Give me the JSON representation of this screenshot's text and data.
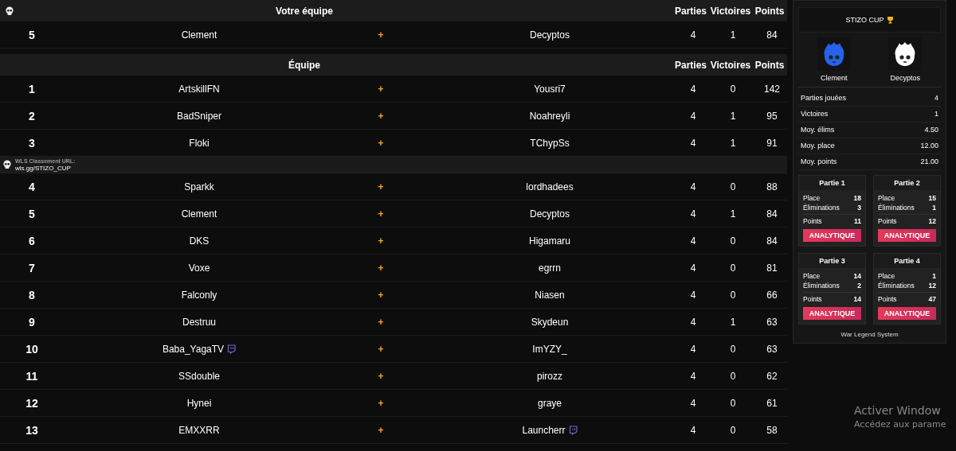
{
  "your_team": {
    "title": "Votre équipe",
    "columns": [
      "Parties",
      "Victoires",
      "Points"
    ],
    "rows": [
      {
        "rank": "5",
        "player_1": {
          "name": "Clement",
          "stream": false
        },
        "plus": "+",
        "player_2": {
          "name": "Decyptos",
          "stream": false
        },
        "parties": "4",
        "victoires": "1",
        "points": "84"
      }
    ]
  },
  "standings": {
    "title": "Équipe",
    "columns": [
      "Parties",
      "Victoires",
      "Points"
    ],
    "rows_top": [
      {
        "rank": "1",
        "player_1": {
          "name": "ArtskillFN",
          "stream": false
        },
        "plus": "+",
        "player_2": {
          "name": "Yousri7",
          "stream": false
        },
        "parties": "4",
        "victoires": "0",
        "points": "142"
      },
      {
        "rank": "2",
        "player_1": {
          "name": "BadSniper",
          "stream": false
        },
        "plus": "+",
        "player_2": {
          "name": "Noahreyli",
          "stream": false
        },
        "parties": "4",
        "victoires": "1",
        "points": "95"
      },
      {
        "rank": "3",
        "player_1": {
          "name": "Floki",
          "stream": false
        },
        "plus": "+",
        "player_2": {
          "name": "TChypSs",
          "stream": false
        },
        "parties": "4",
        "victoires": "1",
        "points": "91"
      }
    ],
    "banner": {
      "label": "WLS Classement URL:",
      "url": "wls.gg/STIZO_CUP"
    },
    "rows_bottom": [
      {
        "rank": "4",
        "player_1": {
          "name": "Sparkk",
          "stream": false
        },
        "plus": "+",
        "player_2": {
          "name": "lordhadees",
          "stream": false
        },
        "parties": "4",
        "victoires": "0",
        "points": "88"
      },
      {
        "rank": "5",
        "player_1": {
          "name": "Clement",
          "stream": false
        },
        "plus": "+",
        "player_2": {
          "name": "Decyptos",
          "stream": false
        },
        "parties": "4",
        "victoires": "1",
        "points": "84"
      },
      {
        "rank": "6",
        "player_1": {
          "name": "DKS",
          "stream": false
        },
        "plus": "+",
        "player_2": {
          "name": "Higamaru",
          "stream": false
        },
        "parties": "4",
        "victoires": "0",
        "points": "84"
      },
      {
        "rank": "7",
        "player_1": {
          "name": "Voxe",
          "stream": false
        },
        "plus": "+",
        "player_2": {
          "name": "egrrn",
          "stream": false
        },
        "parties": "4",
        "victoires": "0",
        "points": "81"
      },
      {
        "rank": "8",
        "player_1": {
          "name": "Falconly",
          "stream": false
        },
        "plus": "+",
        "player_2": {
          "name": "Niasen",
          "stream": false
        },
        "parties": "4",
        "victoires": "0",
        "points": "66"
      },
      {
        "rank": "9",
        "player_1": {
          "name": "Destruu",
          "stream": false
        },
        "plus": "+",
        "player_2": {
          "name": "Skydeun",
          "stream": false
        },
        "parties": "4",
        "victoires": "1",
        "points": "63"
      },
      {
        "rank": "10",
        "player_1": {
          "name": "Baba_YagaTV",
          "stream": true
        },
        "plus": "+",
        "player_2": {
          "name": "ImYZY_",
          "stream": false
        },
        "parties": "4",
        "victoires": "0",
        "points": "63"
      },
      {
        "rank": "11",
        "player_1": {
          "name": "SSdouble",
          "stream": false
        },
        "plus": "+",
        "player_2": {
          "name": "pirozz",
          "stream": false
        },
        "parties": "4",
        "victoires": "0",
        "points": "62"
      },
      {
        "rank": "12",
        "player_1": {
          "name": "Hynei",
          "stream": false
        },
        "plus": "+",
        "player_2": {
          "name": "graye",
          "stream": false
        },
        "parties": "4",
        "victoires": "0",
        "points": "61"
      },
      {
        "rank": "13",
        "player_1": {
          "name": "EMXXRR",
          "stream": false
        },
        "plus": "+",
        "player_2": {
          "name": "Launcherr",
          "stream": true
        },
        "parties": "4",
        "victoires": "0",
        "points": "58"
      }
    ]
  },
  "side_panel": {
    "title": "STIZO CUP",
    "players": [
      {
        "name": "Clement",
        "color": "#2563eb"
      },
      {
        "name": "Decyptos",
        "color": "#ffffff"
      }
    ],
    "stats": [
      {
        "label": "Parties jouées",
        "value": "4"
      },
      {
        "label": "Victoires",
        "value": "1"
      },
      {
        "label": "Moy. élims",
        "value": "4.50"
      },
      {
        "label": "Moy. place",
        "value": "12.00"
      },
      {
        "label": "Moy. points",
        "value": "21.00"
      }
    ],
    "games": [
      {
        "title": "Partie 1",
        "lines": [
          {
            "label": "Place",
            "value": "18"
          },
          {
            "label": "Éliminations",
            "value": "3"
          },
          {
            "label": "Points",
            "value": "11"
          }
        ],
        "button": "ANALYTIQUE"
      },
      {
        "title": "Partie 2",
        "lines": [
          {
            "label": "Place",
            "value": "15"
          },
          {
            "label": "Éliminations",
            "value": "1"
          },
          {
            "label": "Points",
            "value": "12"
          }
        ],
        "button": "ANALYTIQUE"
      },
      {
        "title": "Partie 3",
        "lines": [
          {
            "label": "Place",
            "value": "14"
          },
          {
            "label": "Éliminations",
            "value": "2"
          },
          {
            "label": "Points",
            "value": "14"
          }
        ],
        "button": "ANALYTIQUE"
      },
      {
        "title": "Partie 4",
        "lines": [
          {
            "label": "Place",
            "value": "1"
          },
          {
            "label": "Éliminations",
            "value": "12"
          },
          {
            "label": "Points",
            "value": "47"
          }
        ],
        "button": "ANALYTIQUE"
      }
    ],
    "footer": "War Legend System"
  },
  "os_notice": {
    "title": "Activer Window",
    "text": "Accédez aux parame"
  }
}
